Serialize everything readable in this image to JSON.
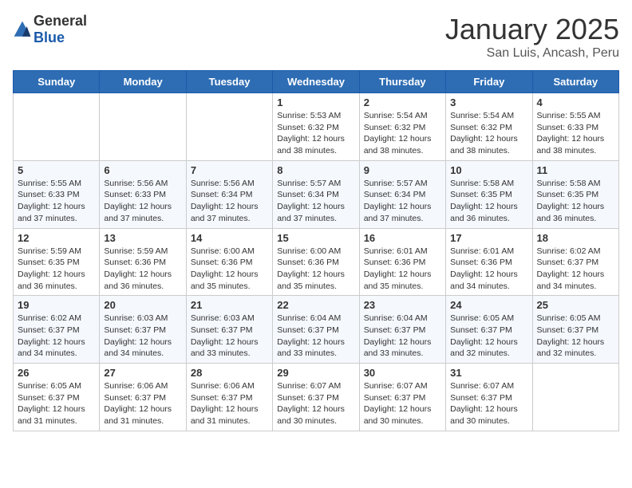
{
  "header": {
    "logo_general": "General",
    "logo_blue": "Blue",
    "title": "January 2025",
    "subtitle": "San Luis, Ancash, Peru"
  },
  "weekdays": [
    "Sunday",
    "Monday",
    "Tuesday",
    "Wednesday",
    "Thursday",
    "Friday",
    "Saturday"
  ],
  "weeks": [
    [
      {
        "day": "",
        "info": ""
      },
      {
        "day": "",
        "info": ""
      },
      {
        "day": "",
        "info": ""
      },
      {
        "day": "1",
        "info": "Sunrise: 5:53 AM\nSunset: 6:32 PM\nDaylight: 12 hours and 38 minutes."
      },
      {
        "day": "2",
        "info": "Sunrise: 5:54 AM\nSunset: 6:32 PM\nDaylight: 12 hours and 38 minutes."
      },
      {
        "day": "3",
        "info": "Sunrise: 5:54 AM\nSunset: 6:32 PM\nDaylight: 12 hours and 38 minutes."
      },
      {
        "day": "4",
        "info": "Sunrise: 5:55 AM\nSunset: 6:33 PM\nDaylight: 12 hours and 38 minutes."
      }
    ],
    [
      {
        "day": "5",
        "info": "Sunrise: 5:55 AM\nSunset: 6:33 PM\nDaylight: 12 hours and 37 minutes."
      },
      {
        "day": "6",
        "info": "Sunrise: 5:56 AM\nSunset: 6:33 PM\nDaylight: 12 hours and 37 minutes."
      },
      {
        "day": "7",
        "info": "Sunrise: 5:56 AM\nSunset: 6:34 PM\nDaylight: 12 hours and 37 minutes."
      },
      {
        "day": "8",
        "info": "Sunrise: 5:57 AM\nSunset: 6:34 PM\nDaylight: 12 hours and 37 minutes."
      },
      {
        "day": "9",
        "info": "Sunrise: 5:57 AM\nSunset: 6:34 PM\nDaylight: 12 hours and 37 minutes."
      },
      {
        "day": "10",
        "info": "Sunrise: 5:58 AM\nSunset: 6:35 PM\nDaylight: 12 hours and 36 minutes."
      },
      {
        "day": "11",
        "info": "Sunrise: 5:58 AM\nSunset: 6:35 PM\nDaylight: 12 hours and 36 minutes."
      }
    ],
    [
      {
        "day": "12",
        "info": "Sunrise: 5:59 AM\nSunset: 6:35 PM\nDaylight: 12 hours and 36 minutes."
      },
      {
        "day": "13",
        "info": "Sunrise: 5:59 AM\nSunset: 6:36 PM\nDaylight: 12 hours and 36 minutes."
      },
      {
        "day": "14",
        "info": "Sunrise: 6:00 AM\nSunset: 6:36 PM\nDaylight: 12 hours and 35 minutes."
      },
      {
        "day": "15",
        "info": "Sunrise: 6:00 AM\nSunset: 6:36 PM\nDaylight: 12 hours and 35 minutes."
      },
      {
        "day": "16",
        "info": "Sunrise: 6:01 AM\nSunset: 6:36 PM\nDaylight: 12 hours and 35 minutes."
      },
      {
        "day": "17",
        "info": "Sunrise: 6:01 AM\nSunset: 6:36 PM\nDaylight: 12 hours and 34 minutes."
      },
      {
        "day": "18",
        "info": "Sunrise: 6:02 AM\nSunset: 6:37 PM\nDaylight: 12 hours and 34 minutes."
      }
    ],
    [
      {
        "day": "19",
        "info": "Sunrise: 6:02 AM\nSunset: 6:37 PM\nDaylight: 12 hours and 34 minutes."
      },
      {
        "day": "20",
        "info": "Sunrise: 6:03 AM\nSunset: 6:37 PM\nDaylight: 12 hours and 34 minutes."
      },
      {
        "day": "21",
        "info": "Sunrise: 6:03 AM\nSunset: 6:37 PM\nDaylight: 12 hours and 33 minutes."
      },
      {
        "day": "22",
        "info": "Sunrise: 6:04 AM\nSunset: 6:37 PM\nDaylight: 12 hours and 33 minutes."
      },
      {
        "day": "23",
        "info": "Sunrise: 6:04 AM\nSunset: 6:37 PM\nDaylight: 12 hours and 33 minutes."
      },
      {
        "day": "24",
        "info": "Sunrise: 6:05 AM\nSunset: 6:37 PM\nDaylight: 12 hours and 32 minutes."
      },
      {
        "day": "25",
        "info": "Sunrise: 6:05 AM\nSunset: 6:37 PM\nDaylight: 12 hours and 32 minutes."
      }
    ],
    [
      {
        "day": "26",
        "info": "Sunrise: 6:05 AM\nSunset: 6:37 PM\nDaylight: 12 hours and 31 minutes."
      },
      {
        "day": "27",
        "info": "Sunrise: 6:06 AM\nSunset: 6:37 PM\nDaylight: 12 hours and 31 minutes."
      },
      {
        "day": "28",
        "info": "Sunrise: 6:06 AM\nSunset: 6:37 PM\nDaylight: 12 hours and 31 minutes."
      },
      {
        "day": "29",
        "info": "Sunrise: 6:07 AM\nSunset: 6:37 PM\nDaylight: 12 hours and 30 minutes."
      },
      {
        "day": "30",
        "info": "Sunrise: 6:07 AM\nSunset: 6:37 PM\nDaylight: 12 hours and 30 minutes."
      },
      {
        "day": "31",
        "info": "Sunrise: 6:07 AM\nSunset: 6:37 PM\nDaylight: 12 hours and 30 minutes."
      },
      {
        "day": "",
        "info": ""
      }
    ]
  ]
}
